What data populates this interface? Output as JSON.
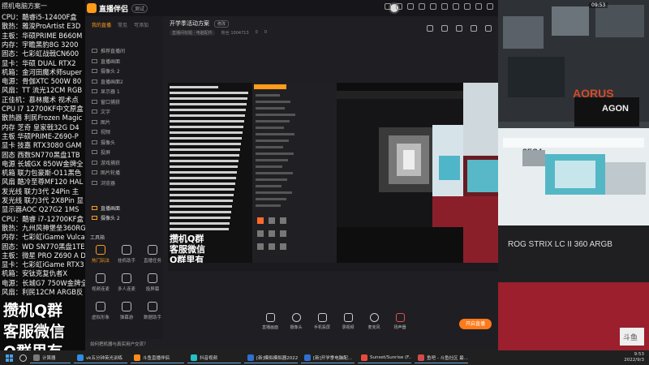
{
  "overlay": {
    "top_line": "攒机电脑方案一",
    "specs": [
      "CPU：酷睿i5-12400F盒",
      "散热：雅浚ProArtist E3D",
      "主板：华硕PRIME B660M",
      "内存：宇瞻黑豹8G 3200",
      "固态：七彩虹战戟CN600",
      "显卡：华硕 DUAL RTX2",
      "机箱：金河田魔术师super",
      "电源：骨伽XTC 500W 80",
      "风扇：TT 流光12CM RGB",
      "正佳机：慕林魔术 视术点",
      "CPU I7 12700KF中文原盒",
      "散热器 利民Frozen Magic",
      "内存 芝奇 皇家戟32G D4",
      "主板 华硕PRIME-Z690-P",
      "显卡 技嘉 RTX3080 GAM",
      "固态 西数SN770黑盘1TB",
      "电源 长城GX 850W金牌全",
      "机箱 联力包豪斯-O11黑色",
      "风扇 酷冷至尊MF120 HAL",
      "发光线 联力3代 24Pin 主",
      "发光线 联力3代 2X8Pin 显",
      "显示器AOC Q27G2 1MS",
      "CPU：酷睿 i7-12700KF盒",
      "散热：九州风神堡垒360RG",
      "内存：七彩虹iGame Vulca",
      "固态：WD SN770黑盘1TE",
      "主板：微星 PRO Z690 A D",
      "显卡：七彩虹iGame RTX3",
      "机箱：安钛克复仇者X",
      "电源：长城G7 750W金牌全",
      "风扇：利民12CM ARGB反"
    ],
    "big_lines": [
      "攒机Q群",
      "客服微信",
      "Q群里有"
    ]
  },
  "app": {
    "title": "直播伴侣",
    "version": "测试",
    "scene_tabs": [
      "我的直播",
      "常见",
      "可添加"
    ],
    "sources": [
      "推荐直播间",
      "直播画面",
      "摄像头 2",
      "直播画面2",
      "显示器 1",
      "窗口捕获",
      "文字",
      "图片",
      "视频",
      "摄像头",
      "投屏",
      "游戏捕获",
      "图片轮播",
      "浏览器"
    ],
    "sources_bottom": [
      "直播画面",
      "摄像头 2"
    ],
    "tools_label": "工具箱",
    "tools": [
      {
        "label": "热门玩法",
        "active": true
      },
      {
        "label": "挂机助手",
        "active": false
      },
      {
        "label": "直播任务",
        "active": false
      },
      {
        "label": "视频连麦",
        "active": false
      },
      {
        "label": "多人连麦",
        "active": false
      },
      {
        "label": "投屏幕",
        "active": false
      },
      {
        "label": "虚拟形象",
        "active": false
      },
      {
        "label": "弹幕游",
        "active": false
      },
      {
        "label": "数据助手",
        "active": false
      }
    ],
    "stream_title": "开学季活动方案",
    "stream_tag": "修改",
    "sub_info": [
      "直播间标题 · 电脑配件",
      "粉丝 1004713",
      "0",
      "0"
    ],
    "bottom_buttons": [
      "直播画面",
      "摄像头",
      "手机投屏",
      "录视频",
      "麦克风",
      "扬声器"
    ],
    "go_live": "开启直播",
    "notice": "如何把机器与真实用户交流？"
  },
  "preview": {
    "nested_big": [
      "攒机Q群",
      "客服微信",
      "Q群里有"
    ]
  },
  "camera": {
    "clock": "09:53",
    "brand_1": "AORUS",
    "brand_2": "AGON",
    "brand_3": "SEGA",
    "product": "ROG STRIX LC II 360 ARGB",
    "logo": "斗鱼"
  },
  "taskbar": {
    "items": [
      {
        "label": "计算器",
        "color": "#7a7a7a"
      },
      {
        "label": "vk五分钟英光训练",
        "color": "#2f8de4"
      },
      {
        "label": "斗鱼直播伴侣",
        "color": "#ff8c1a"
      },
      {
        "label": "抖音视频",
        "color": "#22c1c3"
      },
      {
        "label": "[新]模拟模拟器2022",
        "color": "#2f6fd1"
      },
      {
        "label": "[新]开学季电脑配...",
        "color": "#2f6fd1"
      },
      {
        "label": "Sunset/Sunrise (F..)",
        "color": "#e84b3c"
      },
      {
        "label": "鱼吧 - 斗鱼社区 最...",
        "color": "#d44a4a"
      }
    ],
    "time": "9:53",
    "date": "2022/9/3"
  }
}
